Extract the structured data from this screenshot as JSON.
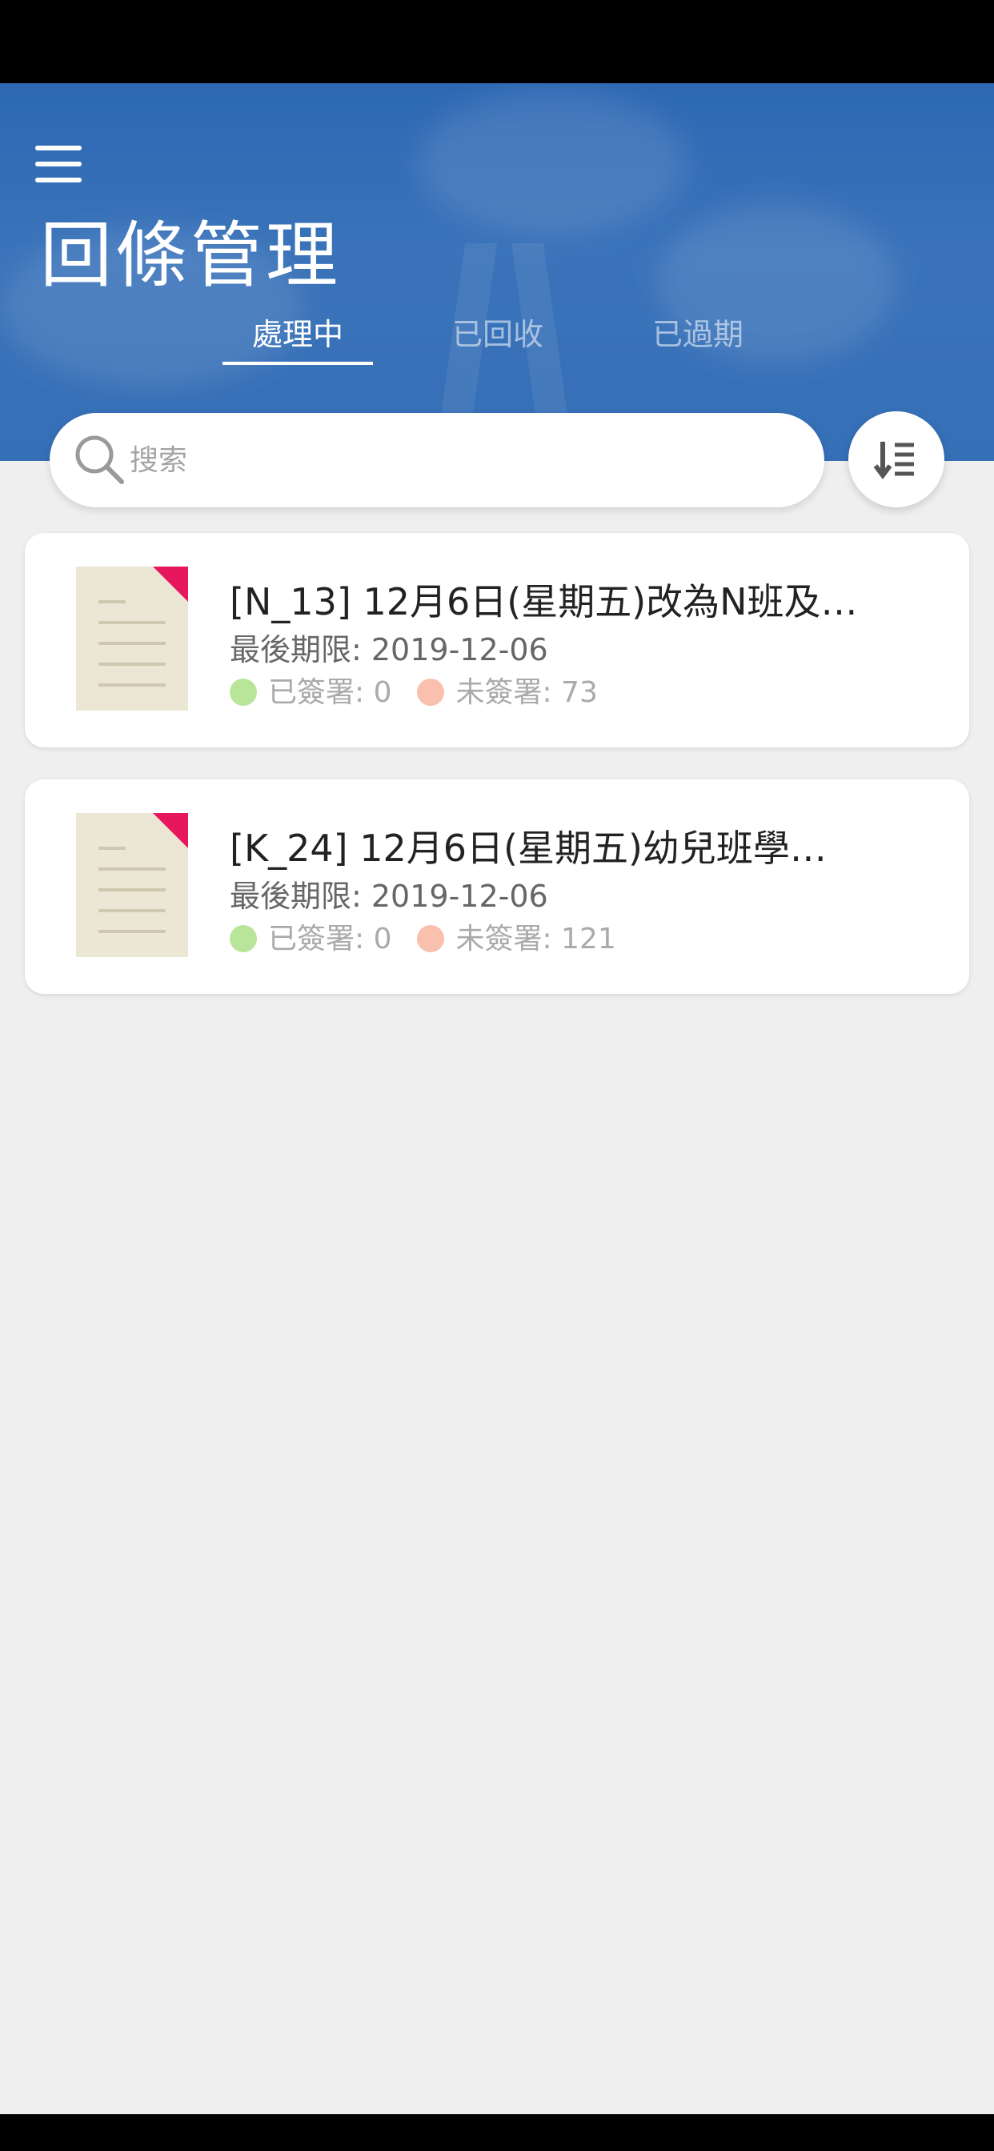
{
  "header": {
    "title": "回條管理",
    "tabs": [
      {
        "label": "處理中",
        "active": true
      },
      {
        "label": "已回收",
        "active": false
      },
      {
        "label": "已過期",
        "active": false
      }
    ]
  },
  "search": {
    "placeholder": "搜索"
  },
  "cards": [
    {
      "title": "[N_13] 12月6日(星期五)改為N班及…",
      "deadline_label": "最後期限: 2019-12-06",
      "signed_label": "已簽署: 0",
      "unsigned_label": "未簽署: 73"
    },
    {
      "title": "[K_24] 12月6日(星期五)幼兒班學…",
      "deadline_label": "最後期限: 2019-12-06",
      "signed_label": "已簽署: 0",
      "unsigned_label": "未簽署: 121"
    }
  ],
  "colors": {
    "header_blue": "#3a73ba",
    "signed_dot": "#b9e59a",
    "unsigned_dot": "#f9c0ae",
    "doc_corner": "#e8175d",
    "doc_paper": "#ece7d4"
  },
  "icons": [
    "menu-icon",
    "search-icon",
    "sort-icon",
    "document-icon"
  ]
}
